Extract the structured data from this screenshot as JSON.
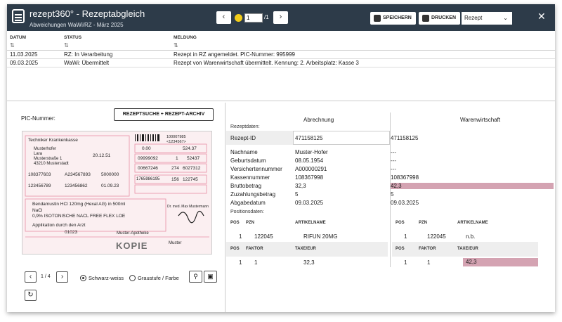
{
  "header": {
    "title": "rezept360° - Rezeptabgleich",
    "subtitle": "Abweichungen WaWi/RZ - März 2025",
    "page_current": "1",
    "page_total": "/1",
    "save_label": "SPEICHERN",
    "print_label": "DRUCKEN",
    "print_select": "Rezept",
    "prev_icon": "‹",
    "next_icon": "›",
    "close_icon": "✕"
  },
  "log": {
    "columns": [
      "DATUM",
      "STATUS",
      "MELDUNG"
    ],
    "sort_icon": "⇅",
    "rows": [
      {
        "date": "11.03.2025",
        "status": "RZ: In Verarbeitung",
        "message": "Rezept in RZ angemeldet. PIC-Nummer: 995999"
      },
      {
        "date": "09.03.2025",
        "status": "WaWi: Übermittelt",
        "message": "Rezept von Warenwirtschaft übermittelt. Kennung: 2. Arbeitsplatz: Kasse 3"
      }
    ]
  },
  "left": {
    "pic_label": "PIC-Nummer:",
    "search_button": "REZEPTSUCHE + REZEPT-ARCHIV",
    "image_page": "1 / 4",
    "radio_bw": "Schwarz-weiss",
    "radio_gray": "Graustufe / Farbe",
    "rx": {
      "insurer": "Techniker Krankenkasse",
      "name1": "Musterhofer",
      "name2": "Lara",
      "street": "Musterstraße 1",
      "city": "43210 Musterstadt",
      "birth": "20.12.51",
      "kv_nr": "108377603",
      "patient_nr": "A234567893",
      "status": "5000000",
      "bsnr": "123456789",
      "lanr": "123456862",
      "date": "01.09.23",
      "top_nr1": "100007985",
      "top_nr2": "<1234567>",
      "amt1": "0.00",
      "amt2": "524.37",
      "pzn1": "09999092",
      "n1": "1",
      "v1": "52437",
      "pzn2": "00667246",
      "n2": "274",
      "v2": "6027312",
      "pzn3": "1765986195",
      "n3": "156",
      "v3": "122745",
      "line1": "Bendamustin HCl 120mg (Hexal AG) in 500ml",
      "line2": "NaCl",
      "line3": "0,9% ISOTONISCHE NACL FREE FLEX LOE",
      "line4": "Applikation durch den Arzt",
      "pzn_bottom": "01023",
      "pharmacy": "Muster-Apotheke",
      "doctor": "Dr. med. Max Mustermann",
      "stamp": "KOPIE",
      "signature": "Muster"
    }
  },
  "right": {
    "col_abrechnung": "Abrechnung",
    "col_wawi": "Warenwirtschaft",
    "sect_rezept": "Rezeptdaten:",
    "sect_pos": "Positionsdaten:",
    "fields": [
      {
        "label": "Rezept-ID",
        "a": "471158125",
        "w": "471158125",
        "diff": false
      },
      {
        "label": "Nachname",
        "a": "Muster-Hofer",
        "w": "---",
        "diff": false
      },
      {
        "label": "Geburtsdatum",
        "a": "08.05.1954",
        "w": "---",
        "diff": false
      },
      {
        "label": "Versichertennummer",
        "a": "A000000291",
        "w": "---",
        "diff": false
      },
      {
        "label": "Kassennummer",
        "a": "108367998",
        "w": "108367998",
        "diff": false
      },
      {
        "label": "Bruttobetrag",
        "a": "32,3",
        "w": "42,3",
        "diff": true
      },
      {
        "label": "Zuzahlungsbetrag",
        "a": "5",
        "w": "5",
        "diff": false
      },
      {
        "label": "Abgabedatum",
        "a": "09.03.2025",
        "w": "09.03.2025",
        "diff": false
      }
    ],
    "pos_head": [
      "POS",
      "PZN",
      "ARTIKELNAME"
    ],
    "pos_a": {
      "pos": "1",
      "pzn": "122045",
      "name": "RIFUN 20MG"
    },
    "pos_w": {
      "pos": "1",
      "pzn": "122045",
      "name": "n.b."
    },
    "tax_head": [
      "POS",
      "FAKTOR",
      "TAXE/EUR"
    ],
    "tax_a": {
      "pos": "1",
      "faktor": "1",
      "taxe": "32,3"
    },
    "tax_w": {
      "pos": "1",
      "faktor": "1",
      "taxe": "42,3"
    }
  },
  "colors": {
    "topbar": "#2d3b49",
    "diff": "#d4a3b2",
    "rx_bg": "#fbeff1",
    "accent": "#f1cc1a"
  }
}
